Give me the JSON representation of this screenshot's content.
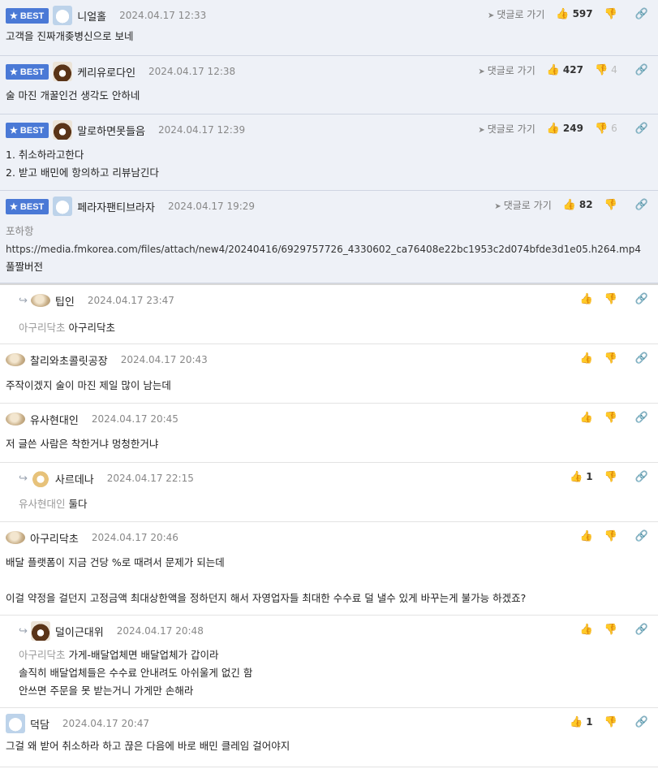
{
  "labels": {
    "best": "★ BEST",
    "goto_reply": "댓글로 가기"
  },
  "colors": {
    "best_bg": "#eef1f7",
    "badge": "#4a79d6"
  },
  "comments": [
    {
      "best": true,
      "avatar": "white-dog-avatar",
      "nick": "니얼홀",
      "date": "2024.04.17 12:33",
      "up": "597",
      "down": "",
      "lines": [
        "고객을 진짜개좆병신으로 보네"
      ]
    },
    {
      "best": true,
      "avatar": "bear-avatar",
      "nick": "케리유로다인",
      "date": "2024.04.17 12:38",
      "up": "427",
      "down": "4",
      "lines": [
        "술 마진 개꿀인건 생각도 안하네"
      ]
    },
    {
      "best": true,
      "avatar": "bear-avatar",
      "nick": "말로하면못들음",
      "date": "2024.04.17 12:39",
      "up": "249",
      "down": "6",
      "lines": [
        "1. 취소하라고한다",
        "2. 받고 배민에 항의하고 리뷰남긴다"
      ]
    },
    {
      "best": true,
      "avatar": "white-dog-avatar",
      "nick": "페라자팬티브라자",
      "date": "2024.04.17 19:29",
      "up": "82",
      "down": "",
      "lines": [
        "포하항",
        "https://media.fmkorea.com/files/attach/new4/20240416/6929757726_4330602_ca76408e22bc1953c2d074bfde3d1e05.h264.mp4",
        "풀짤버전"
      ]
    },
    {
      "reply": true,
      "avatar": "puppy-avatar",
      "nick": "팁인",
      "date": "2024.04.17 23:47",
      "up": "",
      "mention": "아구리닥초",
      "lines": [
        "아구리닥초"
      ]
    },
    {
      "avatar": "blob-avatar",
      "nick": "찰리와초콜릿공장",
      "date": "2024.04.17 20:43",
      "up": "",
      "lines": [
        "주작이겠지 술이 마진 제일 많이 남는데"
      ]
    },
    {
      "avatar": "blob-avatar",
      "nick": "유사현대인",
      "date": "2024.04.17 20:45",
      "up": "",
      "lines": [
        "저 글쓴 사람은 착한거냐 멍청한거냐"
      ]
    },
    {
      "reply": true,
      "avatar": "fox-avatar",
      "nick": "사르데나",
      "date": "2024.04.17 22:15",
      "up": "1",
      "mention": "유사현대인",
      "lines": [
        "둘다"
      ]
    },
    {
      "avatar": "puppy-avatar",
      "nick": "아구리닥초",
      "date": "2024.04.17 20:46",
      "up": "",
      "lines": [
        "배달 플랫폼이 지금 건당 %로 때려서 문제가 되는데",
        "",
        "이걸 약정을 걸던지 고정금액 최대상한액을 정하던지 해서 자영업자들 최대한 수수료 덜 낼수 있게 바꾸는게 불가능 하겠죠?"
      ]
    },
    {
      "reply": true,
      "avatar": "bear-avatar",
      "nick": "덜이근대위",
      "date": "2024.04.17 20:48",
      "up": "",
      "mention": "아구리닥초",
      "lines": [
        "가게-배달업체면 배달업체가 갑이라",
        "솔직히 배달업체들은 수수료 안내려도 아쉬울게 없긴 함",
        "안쓰면 주문을 못 받는거니 가게만 손해라"
      ]
    },
    {
      "avatar": "white-dog-avatar",
      "nick": "덕담",
      "date": "2024.04.17 20:47",
      "up": "1",
      "lines": [
        "그걸 왜 받어 취소하라 하고 끊은 다음에 바로 배민 클레임 걸어야지"
      ]
    }
  ]
}
